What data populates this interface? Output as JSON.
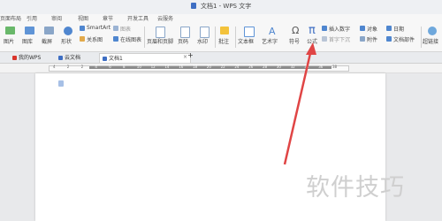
{
  "window": {
    "title": "文档1 - WPS 文字"
  },
  "menu": [
    "页面布局",
    "引用",
    "审阅",
    "视图",
    "章节",
    "开发工具",
    "云服务"
  ],
  "ribbon": {
    "picture": "图片",
    "screenshot": "截屏",
    "shape": "形状",
    "chart_small": "图库",
    "smartart": "SmartArt",
    "chart": "图表",
    "relation": "关系图",
    "online_chart": "在线图表",
    "header_footer": "页眉和页脚",
    "page_number": "页码",
    "watermark": "水印",
    "comment": "批注",
    "textbox": "文本框",
    "art_text": "艺术字",
    "symbol": "符号",
    "formula": "公式",
    "insert_number": "插入数字",
    "object": "对象",
    "date": "日期",
    "first_drop": "首字下沉",
    "attachment": "附件",
    "doc_parts": "文档部件",
    "hyperlink": "超链接",
    "pi_glyph": "π",
    "omega_glyph": "Ω"
  },
  "tabs": [
    {
      "label": "我的WPS",
      "color": "#d9342b"
    },
    {
      "label": "云文档",
      "color": "#3e6ec3"
    },
    {
      "label": "文档1",
      "color": "#3e6ec3"
    }
  ],
  "add_tab": "+",
  "tab_close": "×",
  "ruler_numbers": [
    "4",
    "2",
    "2",
    "4",
    "6",
    "8",
    "10",
    "12",
    "14",
    "16",
    "18",
    "20",
    "22",
    "24",
    "26",
    "28",
    "30",
    "32",
    "34",
    "36",
    "38"
  ],
  "watermark_text": "软件技巧",
  "colors": {
    "accent": "#3e6ec3",
    "arrow": "#e04545"
  }
}
